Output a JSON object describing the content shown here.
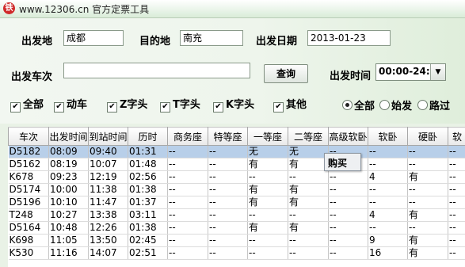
{
  "window": {
    "title": "www.12306.cn 官方定票工具"
  },
  "form": {
    "origin_label": "出发地",
    "origin_value": "成都",
    "destination_label": "目的地",
    "destination_value": "南充",
    "date_label": "出发日期",
    "date_value": "2013-01-23",
    "train_label": "出发车次",
    "train_value": "",
    "query_label": "查询",
    "time_label": "出发时间",
    "time_value": "00:00-24:00"
  },
  "filters": [
    {
      "label": "全部",
      "checked": true
    },
    {
      "label": "动车",
      "checked": true
    },
    {
      "label": "Z字头",
      "checked": true
    },
    {
      "label": "T字头",
      "checked": true
    },
    {
      "label": "K字头",
      "checked": true
    },
    {
      "label": "其他",
      "checked": true
    }
  ],
  "station_options": [
    {
      "label": "全部",
      "selected": true
    },
    {
      "label": "始发",
      "selected": false
    },
    {
      "label": "路过",
      "selected": false
    }
  ],
  "table": {
    "headers": [
      "车次",
      "出发时间",
      "到站时间",
      "历时",
      "商务座",
      "特等座",
      "一等座",
      "二等座",
      "高级软卧",
      "软卧",
      "硬卧",
      "软"
    ],
    "rows": [
      [
        "D5182",
        "08:09",
        "09:40",
        "01:31",
        "--",
        "--",
        "无",
        "无",
        "--",
        "--",
        "--",
        "--"
      ],
      [
        "D5162",
        "08:19",
        "10:07",
        "01:48",
        "--",
        "--",
        "有",
        "有",
        "--",
        "--",
        "--",
        "--"
      ],
      [
        "K678",
        "09:23",
        "12:19",
        "02:56",
        "--",
        "--",
        "--",
        "--",
        "--",
        "4",
        "有",
        "--"
      ],
      [
        "D5174",
        "10:00",
        "11:38",
        "01:38",
        "--",
        "--",
        "有",
        "有",
        "--",
        "--",
        "--",
        "--"
      ],
      [
        "D5196",
        "10:10",
        "11:47",
        "01:37",
        "--",
        "--",
        "有",
        "有",
        "--",
        "--",
        "--",
        "--"
      ],
      [
        "T248",
        "10:27",
        "13:38",
        "03:11",
        "--",
        "--",
        "--",
        "--",
        "--",
        "4",
        "有",
        "--"
      ],
      [
        "D5164",
        "10:48",
        "12:26",
        "01:38",
        "--",
        "--",
        "有",
        "有",
        "--",
        "--",
        "--",
        "--"
      ],
      [
        "K698",
        "11:05",
        "13:50",
        "02:45",
        "--",
        "--",
        "--",
        "--",
        "--",
        "9",
        "有",
        "--"
      ],
      [
        "K530",
        "11:16",
        "14:07",
        "02:51",
        "--",
        "--",
        "--",
        "--",
        "--",
        "16",
        "有",
        "--"
      ]
    ],
    "selected_row": 0
  },
  "context_menu": {
    "item_label": "购买"
  },
  "icons": {
    "app": "railway-logo-icon",
    "dropdown": "dropdown-arrow-icon",
    "check": "check-icon"
  },
  "colors": {
    "selection": "#b8cfe9",
    "background": "#e9f2e6"
  }
}
